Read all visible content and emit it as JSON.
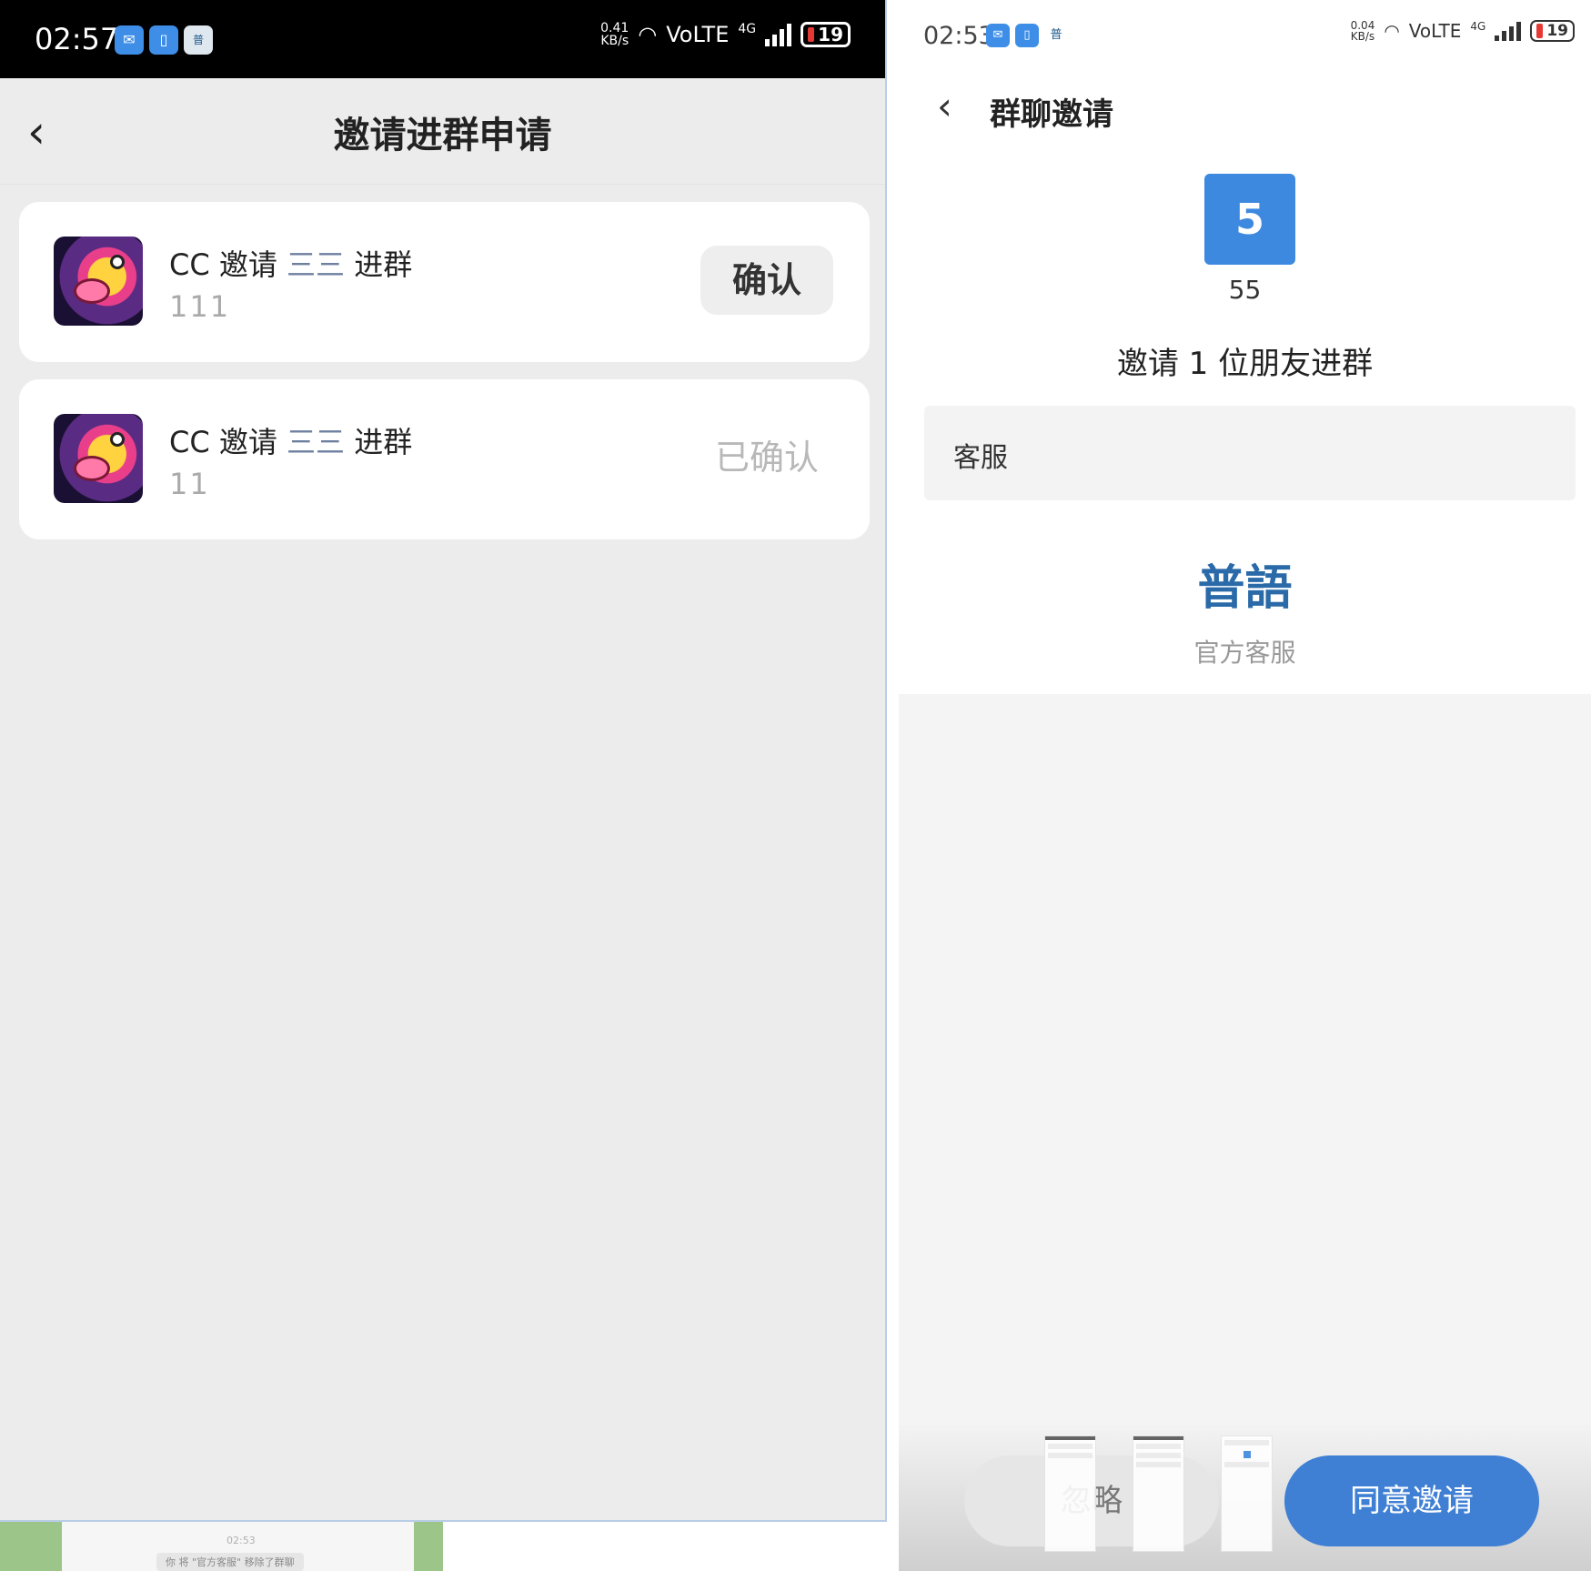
{
  "left": {
    "status": {
      "time": "02:57",
      "net_speed_value": "0.41",
      "net_speed_unit": "KB/s",
      "network": "VoLTE",
      "signal": "4G",
      "battery": "19"
    },
    "nav": {
      "back_icon": "‹",
      "title": "邀请进群申请"
    },
    "requests": [
      {
        "inviter": "CC",
        "verb": "邀请",
        "group": "三三",
        "suffix": "进群",
        "message": "111",
        "action": "确认",
        "state": "pending"
      },
      {
        "inviter": "CC",
        "verb": "邀请",
        "group": "三三",
        "suffix": "进群",
        "message": "11",
        "action": "已确认",
        "state": "confirmed"
      }
    ]
  },
  "strip": {
    "time": "02:53",
    "message": "你 将 \"官方客服\" 移除了群聊"
  },
  "right": {
    "status": {
      "time": "02:53",
      "net_speed_value": "0.04",
      "net_speed_unit": "KB/s",
      "network": "VoLTE",
      "signal": "4G",
      "battery": "19"
    },
    "nav": {
      "back_icon": "‹",
      "title": "群聊邀请"
    },
    "group": {
      "avatar_text": "5",
      "name": "55"
    },
    "invite_text": "邀请 1 位朋友进群",
    "member": "客服",
    "brand": {
      "logo_text": "普語",
      "subtitle": "官方客服"
    },
    "buttons": {
      "ignore": "忽略",
      "accept": "同意邀请"
    },
    "colors": {
      "accent": "#3f7fd4",
      "group_avatar": "#3d89e0"
    }
  }
}
